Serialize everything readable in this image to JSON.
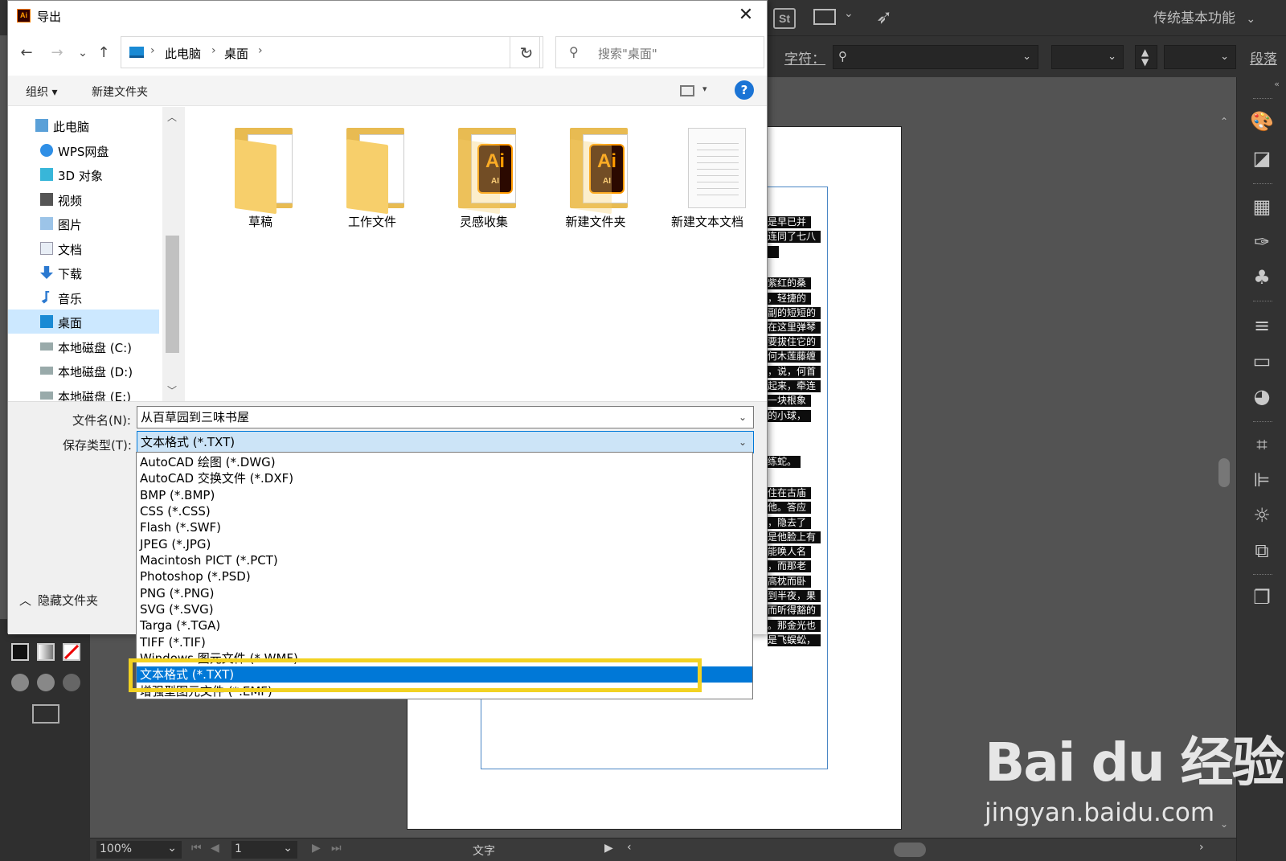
{
  "dialog": {
    "title": "导出",
    "close_glyph": "✕",
    "nav": {
      "back": "←",
      "forward": "→",
      "recent": "⌄",
      "up": "↑",
      "breadcrumb": [
        "此电脑",
        "桌面"
      ],
      "sep": "›",
      "dropdown": "⌄",
      "refresh": "↻",
      "search_placeholder": "搜索\"桌面\""
    },
    "commands": {
      "organize": "组织 ▾",
      "new_folder": "新建文件夹",
      "view_dropdown": "▾",
      "help": "?"
    },
    "nav_items": [
      {
        "label": "此电脑",
        "icon": "computer-icon"
      },
      {
        "label": "WPS网盘",
        "icon": "cloud-icon"
      },
      {
        "label": "3D 对象",
        "icon": "cube-icon"
      },
      {
        "label": "视频",
        "icon": "video-icon"
      },
      {
        "label": "图片",
        "icon": "picture-icon"
      },
      {
        "label": "文档",
        "icon": "document-icon"
      },
      {
        "label": "下载",
        "icon": "download-icon"
      },
      {
        "label": "音乐",
        "icon": "music-icon"
      },
      {
        "label": "桌面",
        "icon": "desktop-icon",
        "selected": true
      },
      {
        "label": "本地磁盘 (C:)",
        "icon": "drive-icon"
      },
      {
        "label": "本地磁盘 (D:)",
        "icon": "drive-icon"
      },
      {
        "label": "本地磁盘 (E:)",
        "icon": "drive-icon"
      }
    ],
    "files": [
      {
        "label": "草稿",
        "type": "folder"
      },
      {
        "label": "工作文件",
        "type": "folder"
      },
      {
        "label": "灵感收集",
        "type": "ai-folder"
      },
      {
        "label": "新建文件夹",
        "type": "ai-folder"
      },
      {
        "label": "新建文本文档",
        "type": "text-file"
      }
    ],
    "ai_badge": {
      "big": "Ai",
      "small": "AI"
    },
    "filename_label": "文件名(N):",
    "filename_value": "从百草园到三味书屋",
    "savetype_label": "保存类型(T):",
    "savetype_value": "文本格式 (*.TXT)",
    "hide_folders": "隐藏文件夹",
    "savetype_options": [
      "AutoCAD 绘图 (*.DWG)",
      "AutoCAD 交换文件 (*.DXF)",
      "BMP (*.BMP)",
      "CSS (*.CSS)",
      "Flash (*.SWF)",
      "JPEG (*.JPG)",
      "Macintosh PICT (*.PCT)",
      "Photoshop (*.PSD)",
      "PNG (*.PNG)",
      "SVG (*.SVG)",
      "Targa (*.TGA)",
      "TIFF (*.TIF)",
      "Windows 图元文件 (*.WMF)",
      "文本格式 (*.TXT)",
      "增强型图元文件 (*.EMF)"
    ],
    "selected_option_index": 13
  },
  "illustrator": {
    "workspace": "传统基本功能",
    "char_label": "字符：",
    "para_label": "段落",
    "zoom": "100%",
    "artboard_num": "1",
    "status_text": "文字",
    "text_lines": [
      "是早已并",
      "连同了七八",
      "",
      "紫红的桑",
      "，轻捷的",
      "副的短短的",
      "在这里弹琴",
      "要拔住它的",
      "何木莲藤缠",
      "，说，何首",
      "起来，牵连",
      "一块根象",
      "的小球，",
      "练蛇。",
      "住在古庙",
      "他。答应",
      "，隐去了",
      "是他脸上有",
      "能唤人名",
      "，而那老",
      "高枕而卧",
      "到半夜，果",
      "而听得豁的",
      "。那金光也",
      "是飞蜈蚣，"
    ]
  },
  "watermark": {
    "logo": "Bai du 经验",
    "url": "jingyan.baidu.com"
  },
  "colors": {
    "selection_blue": "#0078d7",
    "highlight_yellow": "#f2d222",
    "nav_selected": "#cce8ff"
  }
}
